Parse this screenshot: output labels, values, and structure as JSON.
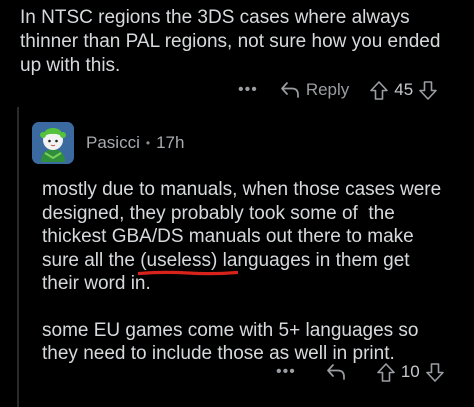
{
  "parent_comment": {
    "lines": [
      "In NTSC regions the 3DS cases where always",
      "thinner than PAL regions, not sure how you ended",
      "up with this."
    ],
    "actions": {
      "more_label": "•••",
      "reply_label": "Reply",
      "vote_count": "45"
    }
  },
  "reply_comment": {
    "username": "Pasicci",
    "separator": "•",
    "age": "17h",
    "para1": {
      "lines": [
        "mostly due to manuals, when those cases were",
        "designed, they probably took some of  the",
        "thickest GBA/DS manuals out there to make"
      ],
      "line4_before": "sure all the ",
      "line4_marked": "(useless)",
      "line4_after": " languages in them get",
      "line5": "their word in."
    },
    "para2": {
      "lines": [
        "some EU games come with 5+ languages so",
        "they need to include those as well in print."
      ]
    },
    "actions": {
      "more_label": "•••",
      "vote_count": "10"
    }
  },
  "colors": {
    "background": "#000000",
    "text": "#d7dadc",
    "muted": "#9a9ea2",
    "annotation_red": "#d8221c"
  }
}
